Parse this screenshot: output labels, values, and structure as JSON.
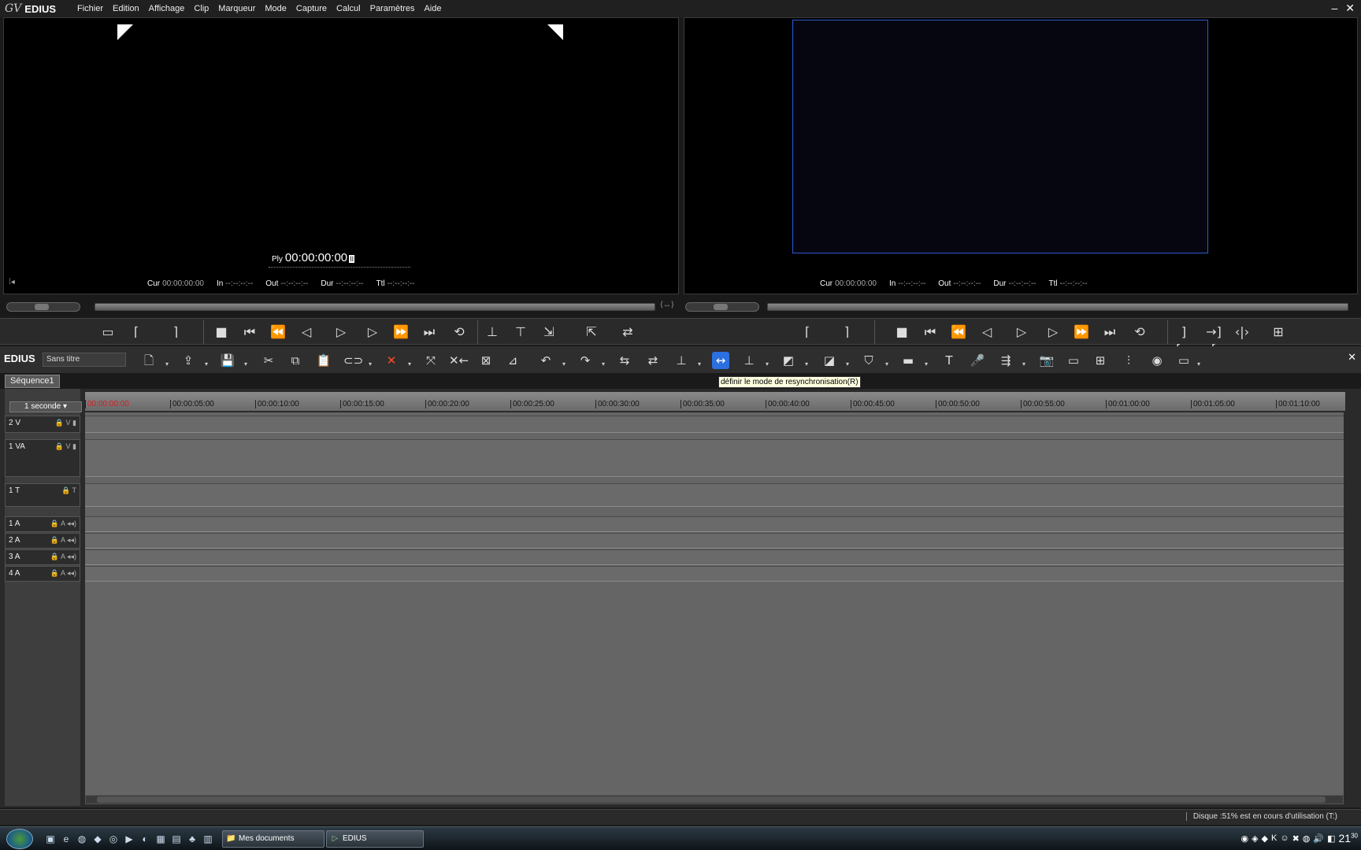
{
  "app": {
    "logo_mark": "GV",
    "name": "EDIUS"
  },
  "menu": [
    "Fichier",
    "Edition",
    "Affichage",
    "Clip",
    "Marqueur",
    "Mode",
    "Capture",
    "Calcul",
    "Paramètres",
    "Aide"
  ],
  "window_buttons": {
    "minimize": "–",
    "close": "✕"
  },
  "player": {
    "ply_label": "Ply",
    "ply_timecode": "00:00:00:00",
    "timecodes": [
      {
        "label": "Cur",
        "value": "00:00:00:00"
      },
      {
        "label": "In",
        "value": "--:--:--:--"
      },
      {
        "label": "Out",
        "value": "--:--:--:--"
      },
      {
        "label": "Dur",
        "value": "--:--:--:--"
      },
      {
        "label": "Ttl",
        "value": "--:--:--:--"
      }
    ]
  },
  "recorder": {
    "timecodes": [
      {
        "label": "Cur",
        "value": "00:00:00:00"
      },
      {
        "label": "In",
        "value": "--:--:--:--"
      },
      {
        "label": "Out",
        "value": "--:--:--:--"
      },
      {
        "label": "Dur",
        "value": "--:--:--:--"
      },
      {
        "label": "Ttl",
        "value": "--:--:--:--"
      }
    ]
  },
  "timeline_toolbar": {
    "app_label": "EDIUS",
    "project_name": "Sans titre",
    "tooltip": "définir le mode de resynchronisation(R)"
  },
  "sequence_tab": "Séquence1",
  "timescale": "1 seconde",
  "ruler_ticks": [
    "00:00:00:00",
    "00:00:05:00",
    "00:00:10:00",
    "00:00:15:00",
    "00:00:20:00",
    "00:00:25:00",
    "00:00:30:00",
    "00:00:35:00",
    "00:00:40:00",
    "00:00:45:00",
    "00:00:50:00",
    "00:00:55:00",
    "00:01:00:00",
    "00:01:05:00",
    "00:01:10:00"
  ],
  "tracks": [
    {
      "label": "2 V",
      "icons": "🔒 V ▮"
    },
    {
      "label": "1 VA",
      "icons": "🔒 V ▮"
    },
    {
      "label": "1 T",
      "icons": "🔒 T"
    },
    {
      "label": "1 A",
      "icons": "🔒 A ◂◂)"
    },
    {
      "label": "2 A",
      "icons": "🔒 A ◂◂)"
    },
    {
      "label": "3 A",
      "icons": "🔒 A ◂◂)"
    },
    {
      "label": "4 A",
      "icons": "🔒 A ◂◂)"
    }
  ],
  "status": {
    "disk": "Disque :51% est en cours d'utilisation (T:)"
  },
  "taskbar": {
    "buttons": [
      {
        "label": "Mes documents",
        "icon": "folder-icon"
      },
      {
        "label": "EDIUS",
        "icon": "edius-icon"
      }
    ],
    "clock": "21",
    "clock_minutes": "30"
  }
}
